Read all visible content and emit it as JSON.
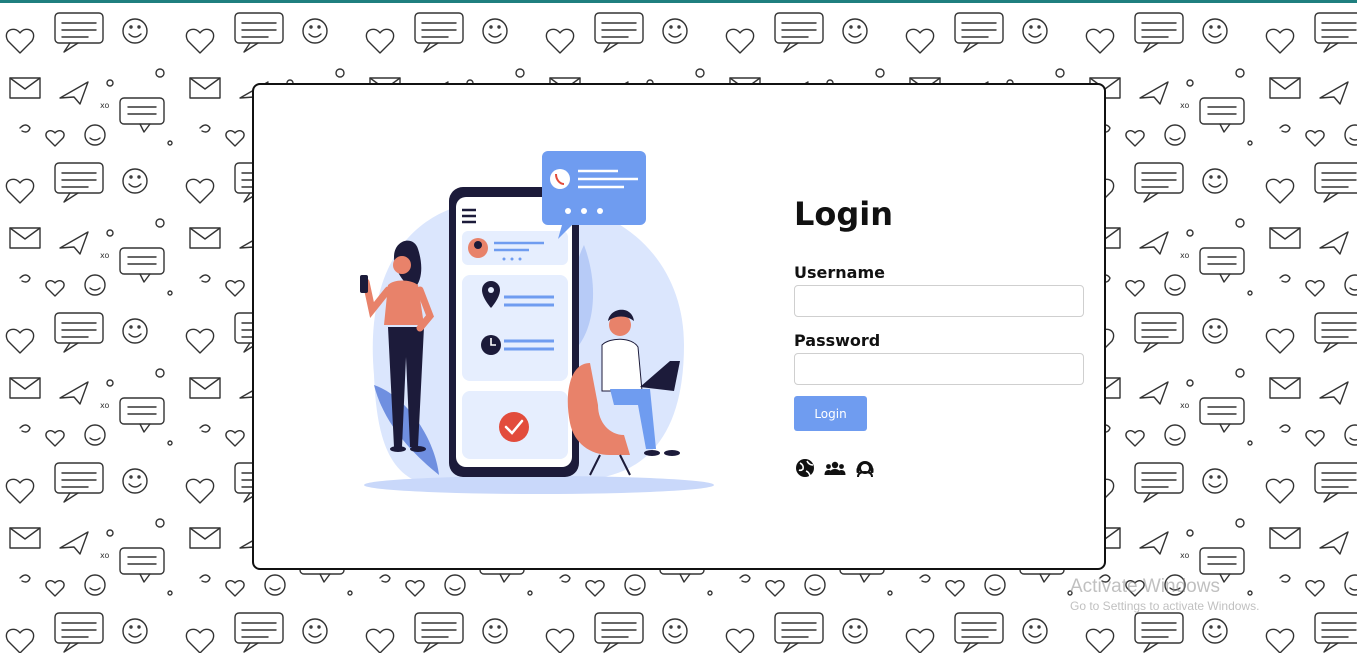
{
  "login": {
    "title": "Login",
    "username_label": "Username",
    "username_value": "",
    "password_label": "Password",
    "password_value": "",
    "button_label": "Login"
  },
  "footer_icons": [
    "globe-icon",
    "users-icon",
    "user-headset-icon"
  ],
  "watermark": {
    "title": "Activate Windows",
    "subtitle": "Go to Settings to activate Windows."
  },
  "colors": {
    "accent": "#6f9cf0",
    "top_bar": "#1f7f7f",
    "illustration_blob": "#dbe6fd",
    "checkmark": "#e24c3c"
  }
}
